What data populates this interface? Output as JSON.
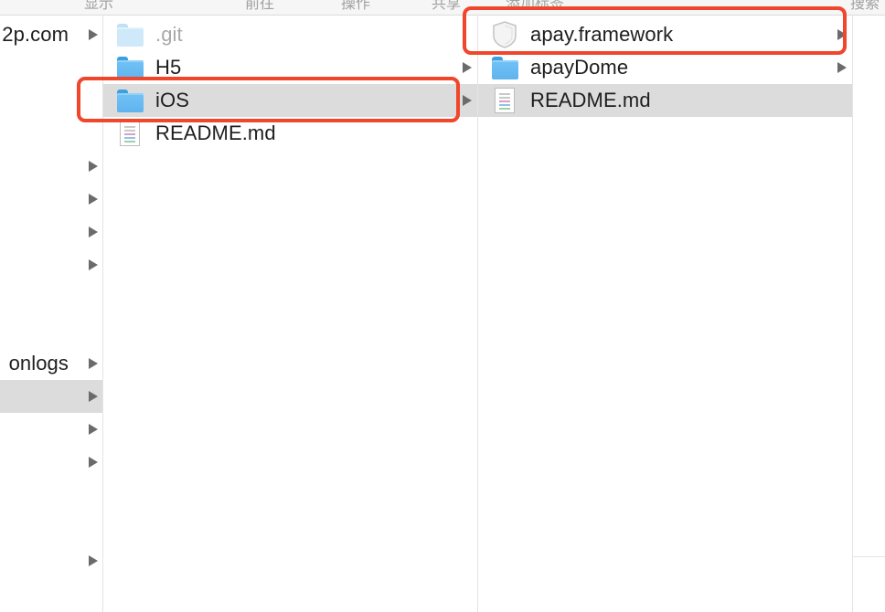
{
  "toolbar": {
    "labels": [
      "显示",
      "前往",
      "操作",
      "共享",
      "添加标签",
      "搜索"
    ]
  },
  "column1": {
    "rows": [
      {
        "label": "2p.com"
      },
      {
        "label": ""
      },
      {
        "label": ""
      },
      {
        "label": ""
      },
      {
        "label": ""
      },
      {
        "label": ""
      },
      {
        "label": ""
      },
      {
        "label": ""
      },
      {
        "label": ""
      },
      {
        "label": ""
      },
      {
        "label": "onlogs"
      },
      {
        "label": ""
      },
      {
        "label": ""
      },
      {
        "label": ""
      },
      {
        "label": ""
      }
    ]
  },
  "column2": {
    "items": [
      {
        "name": ".git",
        "kind": "folder",
        "hidden": true
      },
      {
        "name": "H5",
        "kind": "folder"
      },
      {
        "name": "iOS",
        "kind": "folder",
        "selected": true
      },
      {
        "name": "README.md",
        "kind": "document"
      }
    ]
  },
  "column3": {
    "items": [
      {
        "name": "apay.framework",
        "kind": "framework"
      },
      {
        "name": "apayDome",
        "kind": "folder"
      },
      {
        "name": "README.md",
        "kind": "document",
        "selected": true
      }
    ]
  },
  "colors": {
    "highlight": "#f0462b",
    "selection": "#dcdcdc",
    "folder": "#5fb3ee"
  }
}
